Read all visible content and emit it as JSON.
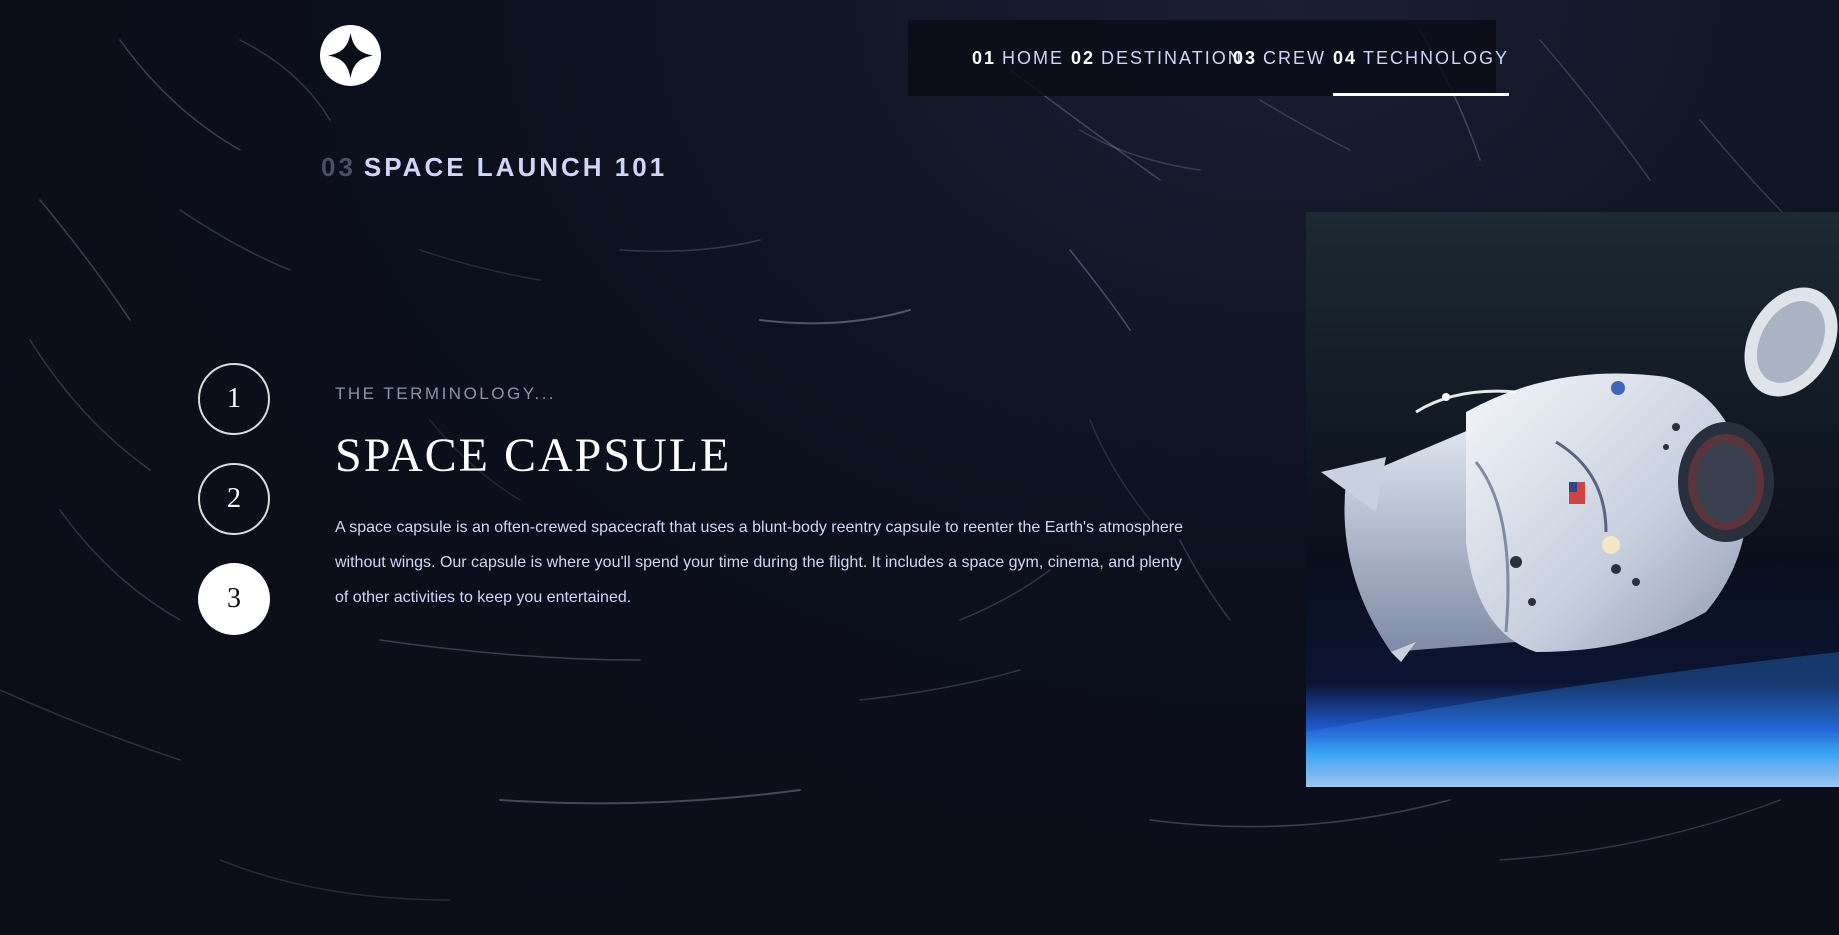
{
  "nav": {
    "items": [
      {
        "num": "01",
        "label": "HOME"
      },
      {
        "num": "02",
        "label": "DESTINATION"
      },
      {
        "num": "03",
        "label": "CREW"
      },
      {
        "num": "04",
        "label": "TECHNOLOGY"
      }
    ],
    "active_index": 3
  },
  "page_heading": {
    "num": "03",
    "label": "SPACE LAUNCH 101"
  },
  "steps": [
    "1",
    "2",
    "3"
  ],
  "active_step": 2,
  "technology": {
    "eyebrow": "THE TERMINOLOGY...",
    "name": "SPACE CAPSULE",
    "description": "A space capsule is an often-crewed spacecraft that uses a blunt-body reentry capsule to reenter the Earth's atmosphere without wings. Our capsule is where you'll spend your time during the flight. It includes a space gym, cinema, and plenty of other activities to keep you entertained."
  },
  "icons": {
    "logo": "four-point-star-icon"
  },
  "colors": {
    "background": "#0b0d17",
    "accent": "#d0d6f9",
    "white": "#ffffff"
  }
}
